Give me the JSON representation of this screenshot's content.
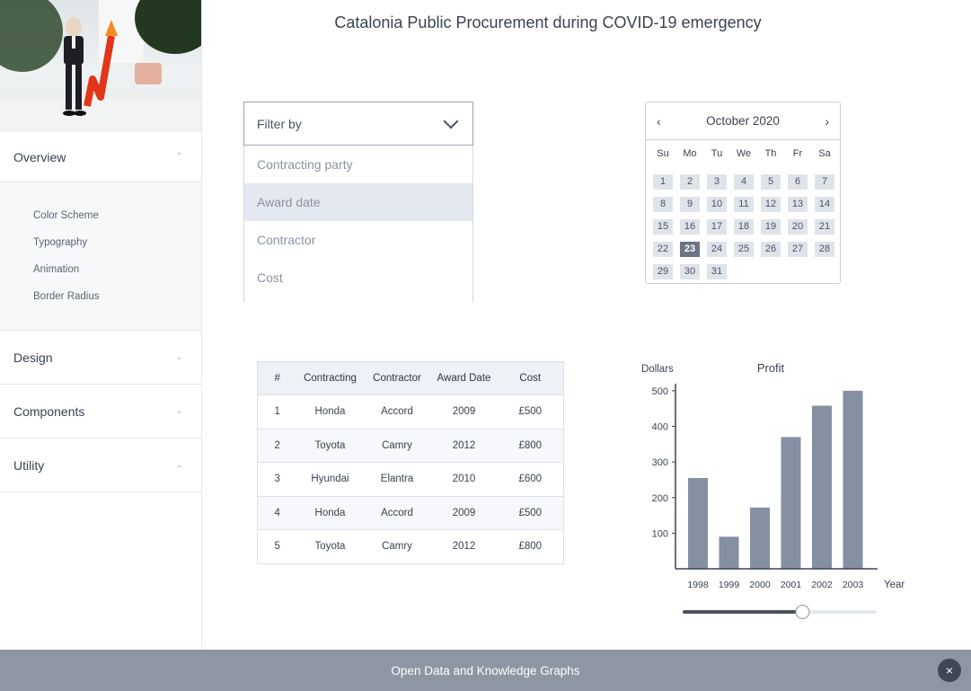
{
  "title": "Catalonia Public Procurement during COVID-19 emergency",
  "sidebar": {
    "sections": [
      {
        "label": "Overview",
        "expanded": true
      },
      {
        "label": "Design",
        "expanded": false
      },
      {
        "label": "Components",
        "expanded": false
      },
      {
        "label": "Utility",
        "expanded": false
      }
    ],
    "overview_subitems": [
      "Color Scheme",
      "Typography",
      "Animation",
      "Border Radius"
    ]
  },
  "filter": {
    "label": "Filter by",
    "options": [
      "Contracting party",
      "Award date",
      "Contractor",
      "Cost"
    ],
    "selected": "Award date"
  },
  "calendar": {
    "month_label": "October 2020",
    "weekdays": [
      "Su",
      "Mo",
      "Tu",
      "We",
      "Th",
      "Fr",
      "Sa"
    ],
    "first_weekday_offset": 0,
    "days": [
      "1",
      "2",
      "3",
      "4",
      "5",
      "6",
      "7",
      "8",
      "9",
      "10",
      "11",
      "12",
      "13",
      "14",
      "15",
      "16",
      "17",
      "18",
      "19",
      "20",
      "21",
      "22",
      "23",
      "24",
      "25",
      "26",
      "27",
      "28",
      "29",
      "30",
      "31"
    ],
    "selected_day": "23"
  },
  "table": {
    "headers": [
      "#",
      "Contracting",
      "Contractor",
      "Award Date",
      "Cost"
    ],
    "rows": [
      [
        "1",
        "Honda",
        "Accord",
        "2009",
        "£500"
      ],
      [
        "2",
        "Toyota",
        "Camry",
        "2012",
        "£800"
      ],
      [
        "3",
        "Hyundai",
        "Elantra",
        "2010",
        "£600"
      ],
      [
        "4",
        "Honda",
        "Accord",
        "2009",
        "£500"
      ],
      [
        "5",
        "Toyota",
        "Camry",
        "2012",
        "£800"
      ]
    ]
  },
  "chart_data": {
    "type": "bar",
    "title": "Profit",
    "xlabel": "Year",
    "ylabel": "Dollars",
    "categories": [
      "1998",
      "1999",
      "2000",
      "2001",
      "2002",
      "2003"
    ],
    "values": [
      255,
      90,
      172,
      370,
      458,
      500
    ],
    "yticks": [
      100,
      200,
      300,
      400,
      500
    ],
    "ylim": [
      0,
      530
    ],
    "bar_color": "#8590a3"
  },
  "slider": {
    "value": 0.62
  },
  "footer": {
    "text": "Open Data and Knowledge Graphs",
    "close_icon": "×"
  },
  "colors": {
    "accent": "#8e95a3",
    "selected": "#6b7485"
  }
}
